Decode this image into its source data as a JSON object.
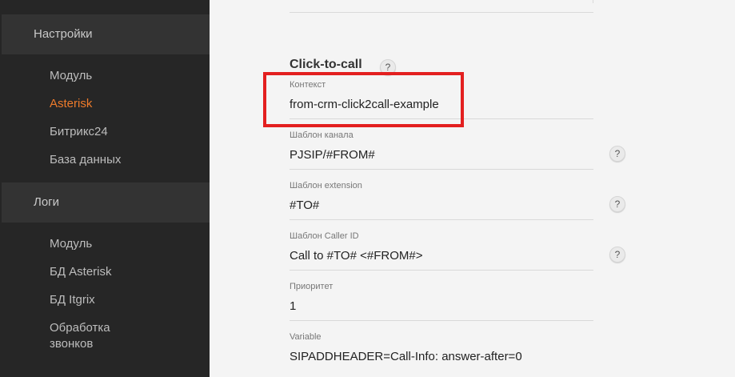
{
  "sidebar": {
    "section1": "Настройки",
    "section1_items": [
      "Модуль",
      "Asterisk",
      "Битрикс24",
      "База данных"
    ],
    "section2": "Логи",
    "section2_items": [
      "Модуль",
      "БД Asterisk",
      "БД Itgrix"
    ],
    "section2_last_line1": "Обработка",
    "section2_last_line2": "звонков",
    "active_item": "Asterisk"
  },
  "main": {
    "section_title": "Click-to-call",
    "help_symbol": "?",
    "fields": [
      {
        "label": "Контекст",
        "value": "from-crm-click2call-example"
      },
      {
        "label": "Шаблон канала",
        "value": "PJSIP/#FROM#"
      },
      {
        "label": "Шаблон extension",
        "value": "#TO#"
      },
      {
        "label": "Шаблон Caller ID",
        "value": "Call to #TO# <#FROM#>"
      },
      {
        "label": "Приоритет",
        "value": "1"
      },
      {
        "label": "Variable",
        "value": "SIPADDHEADER=Call-Info: answer-after=0"
      }
    ]
  },
  "colors": {
    "sidebar_bg": "#262626",
    "section_bg": "#333333",
    "accent": "#ee7b2b",
    "highlight": "#e31f1f",
    "main_bg": "#f4f4f4"
  }
}
